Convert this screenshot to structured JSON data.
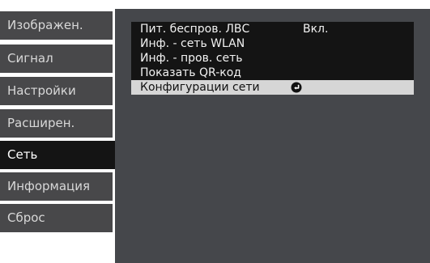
{
  "sidebar": {
    "items": [
      {
        "label": "Изображен."
      },
      {
        "label": "Сигнал"
      },
      {
        "label": "Настройки"
      },
      {
        "label": "Расширен."
      },
      {
        "label": "Сеть"
      },
      {
        "label": "Информация"
      },
      {
        "label": "Сброс"
      }
    ],
    "selected": "Сеть"
  },
  "menu": {
    "items": [
      {
        "label": "Пит. беспров. ЛВС",
        "value": "Вкл."
      },
      {
        "label": "Инф. - сеть WLAN"
      },
      {
        "label": "Инф. - пров. сеть"
      },
      {
        "label": "Показать QR-код"
      },
      {
        "label": "Конфигурации сети",
        "icon": "enter-icon"
      }
    ],
    "selected": "Конфигурации сети"
  },
  "colors": {
    "sidebar_item_bg": "#48484a",
    "sidebar_selected_bg": "#141414",
    "panel_bg": "#45474b",
    "menu_bg": "#141414",
    "menu_selected_bg": "#d6d6d6"
  }
}
